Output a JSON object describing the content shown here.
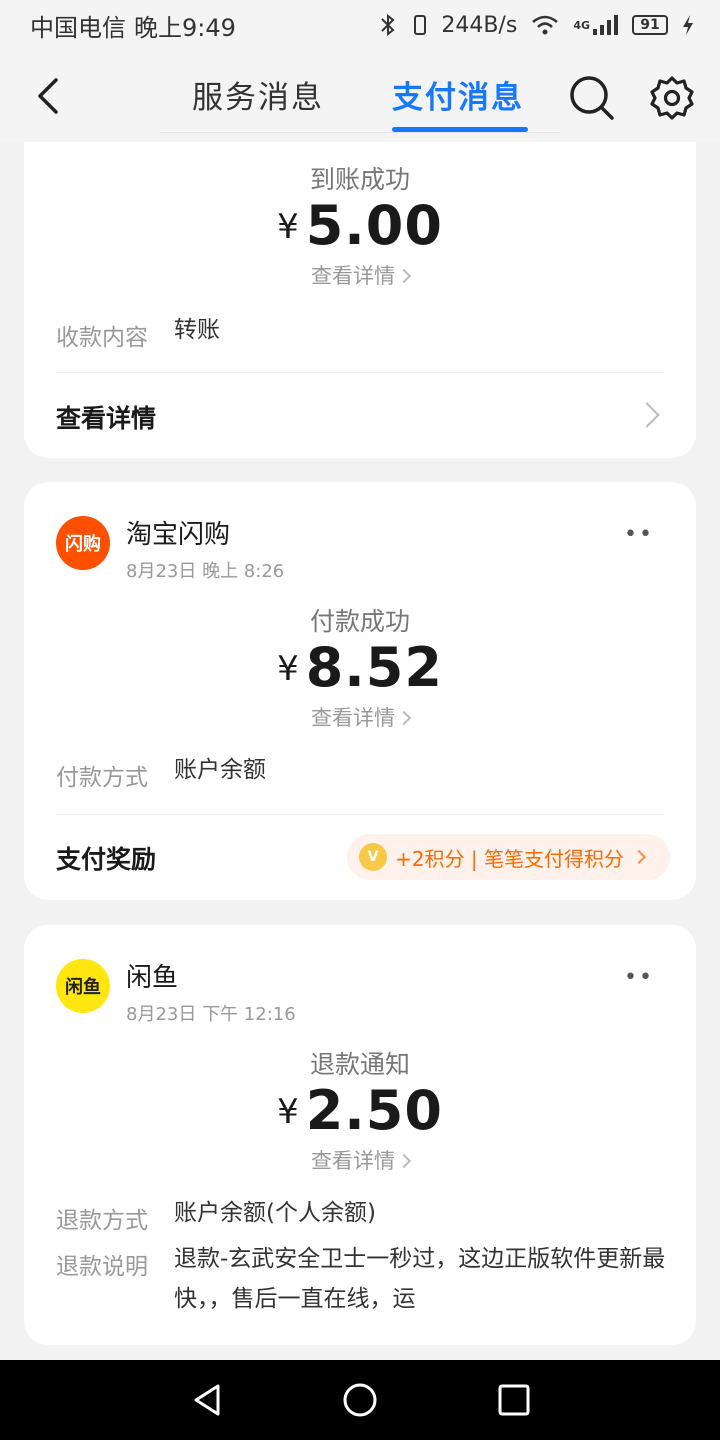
{
  "status_bar": {
    "carrier": "中国电信",
    "time": "晚上9:49",
    "speed": "244B/s",
    "network": "4G",
    "battery": "91"
  },
  "header": {
    "tabs": [
      {
        "label": "服务消息",
        "active": false
      },
      {
        "label": "支付消息",
        "active": true
      }
    ],
    "accent_color": "#1677ff"
  },
  "cards": [
    {
      "status": "到账成功",
      "currency": "¥",
      "amount": "5.00",
      "detail_link": "查看详情",
      "info": [
        {
          "label": "收款内容",
          "value": "转账"
        }
      ],
      "footer_title": "查看详情"
    },
    {
      "merchant": "淘宝闪购",
      "logo_text": "闪购",
      "time": "8月23日 晚上 8:26",
      "more": "••",
      "status": "付款成功",
      "currency": "¥",
      "amount": "8.52",
      "detail_link": "查看详情",
      "info": [
        {
          "label": "付款方式",
          "value": "账户余额"
        }
      ],
      "footer_title": "支付奖励",
      "reward": "+2积分 | 笔笔支付得积分",
      "reward_color": "#ff6a00"
    },
    {
      "merchant": "闲鱼",
      "logo_text": "闲鱼",
      "time": "8月23日 下午 12:16",
      "more": "••",
      "status": "退款通知",
      "currency": "¥",
      "amount": "2.50",
      "detail_link": "查看详情",
      "info": [
        {
          "label": "退款方式",
          "value": "账户余额(个人余额)"
        },
        {
          "label": "退款说明",
          "value": "退款-玄武安全卫士一秒过，这边正版软件更新最快，，售后一直在线，运"
        }
      ]
    }
  ]
}
